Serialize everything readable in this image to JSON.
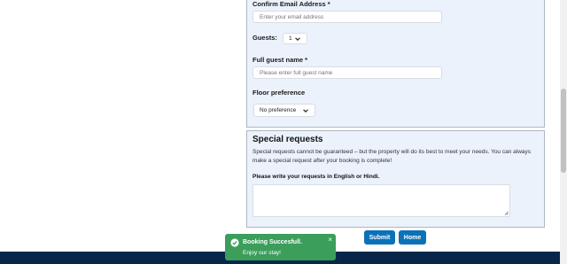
{
  "form": {
    "confirm_email_label": "Confirm Email Address *",
    "confirm_email_placeholder": "Enter your email address",
    "guests_label": "Guests:",
    "guests_value": "1",
    "guest_name_label": "Full guest name *",
    "guest_name_placeholder": "Please enter full guest name",
    "floor_label": "Floor preference",
    "floor_value": "No preference"
  },
  "special_requests": {
    "title": "Special requests",
    "description": "Special requests cannot be guaranteed – but the property will do its best to meet your needs. You can always make a special request after your booking is complete!",
    "textarea_label": "Please write your requests in English or Hindi.",
    "textarea_value": ""
  },
  "actions": {
    "submit_label": "Submit",
    "home_label": "Home"
  },
  "toast": {
    "title": "Booking Succesfull.",
    "message": "Enjoy our stay!",
    "close_glyph": "×"
  },
  "colors": {
    "panel_bg": "#ebf2fc",
    "button_blue": "#0b72b8",
    "toast_green": "#3b9e5b",
    "footer_navy": "#07264a"
  }
}
